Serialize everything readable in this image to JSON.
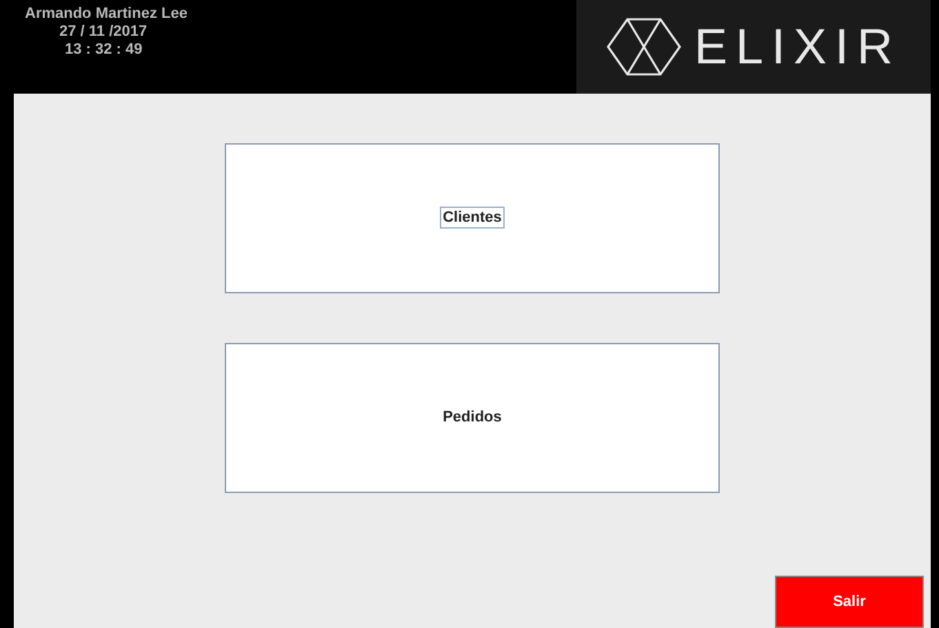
{
  "header": {
    "user": "Armando Martinez Lee",
    "date": "27 / 11 /2017",
    "time": "13 : 32 : 49",
    "logo_text": "ELIXIR"
  },
  "menu_buttons": [
    {
      "label": "Clientes",
      "focused": true
    },
    {
      "label": "Pedidos",
      "focused": false
    }
  ],
  "exit_button": {
    "label": "Salir"
  }
}
